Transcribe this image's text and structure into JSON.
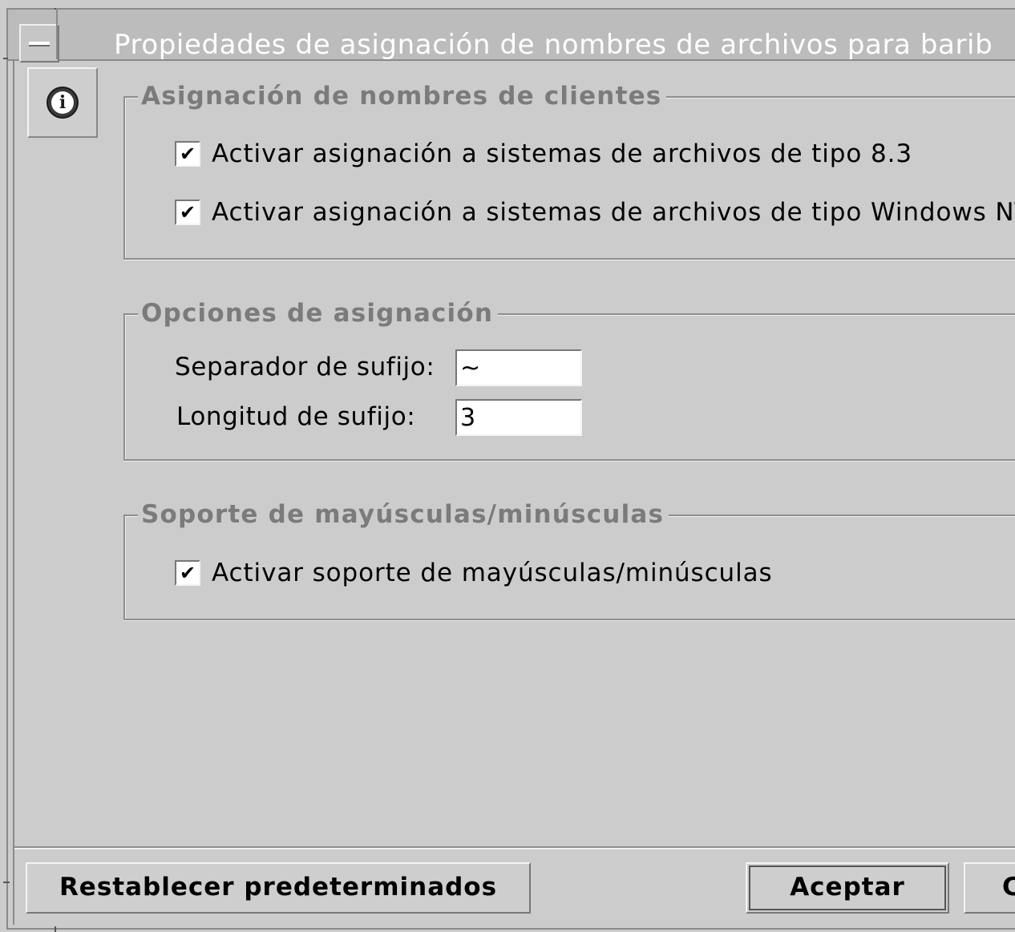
{
  "window": {
    "title": "Propiedades de asignación de nombres de archivos para barib"
  },
  "icons": {
    "window_menu": "window-menu-icon",
    "info": "info-icon"
  },
  "info_glyph": "i",
  "groups": {
    "client_mapping": {
      "title": "Asignación de nombres de clientes",
      "checkboxes": [
        {
          "label": "Activar asignación a sistemas de archivos de tipo 8.3",
          "checked": true
        },
        {
          "label": "Activar asignación a sistemas de archivos de tipo Windows NT",
          "checked": true
        }
      ]
    },
    "mapping_options": {
      "title": "Opciones de asignación",
      "suffix_separator_label": "Separador de sufijo:",
      "suffix_separator_value": "~",
      "suffix_length_label": "Longitud de sufijo:",
      "suffix_length_value": "3"
    },
    "case_support": {
      "title": "Soporte de mayúsculas/minúsculas",
      "checkboxes": [
        {
          "label": "Activar soporte de mayúsculas/minúsculas",
          "checked": true
        }
      ]
    }
  },
  "check_mark": "✔",
  "buttons": {
    "reset": "Restablecer predeterminados",
    "accept": "Aceptar",
    "cancel": "C"
  }
}
